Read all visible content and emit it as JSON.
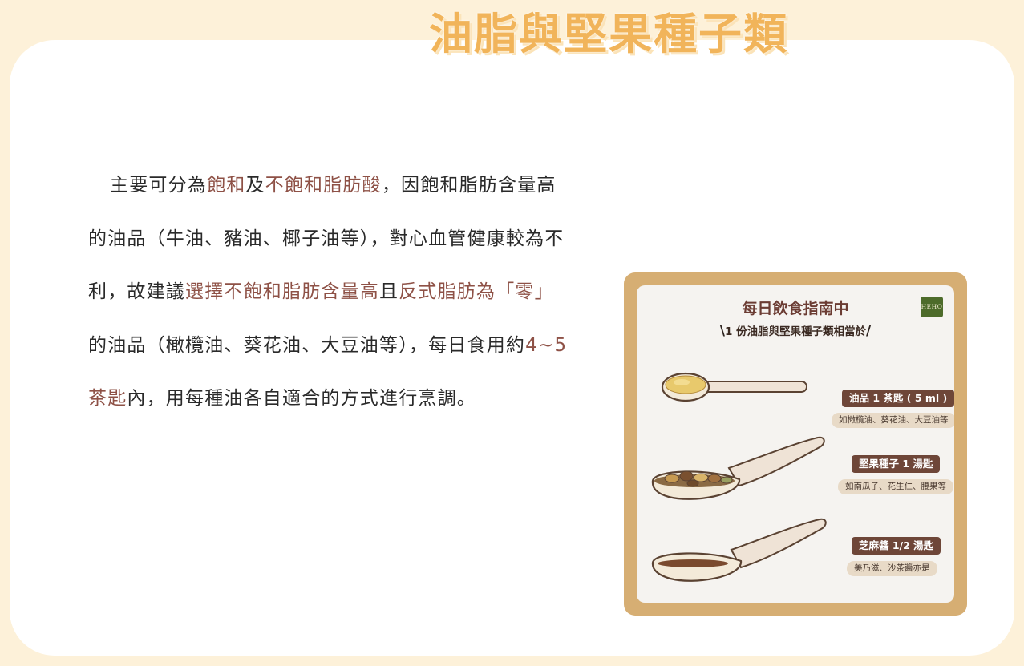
{
  "page": {
    "title": "油脂與堅果種子類"
  },
  "paragraph": {
    "seg1": "主要可分為",
    "seg2": "飽和",
    "seg3": "及",
    "seg4": "不飽和脂肪酸",
    "seg5": "，因飽和脂肪含量高的油品（牛油、豬油、椰子油等），對心血管健康較為不利，故建議",
    "seg6": "選擇不飽和脂肪含量高",
    "seg7": "且",
    "seg8": "反式脂肪為「零」",
    "seg9": "的油品（橄欖油、葵花油、大豆油等），每日食用約",
    "seg10": "4~5 茶匙",
    "seg11": "內，用每種油各自適合的方式進行烹調。"
  },
  "infographic": {
    "title": "每日飲食指南中",
    "subtitle": "1 份油脂與堅果種子類相當於",
    "logo": "HEHO",
    "items": [
      {
        "label": "油品 1 茶匙 ( 5 ml )",
        "examples": "如橄欖油、葵花油、大豆油等"
      },
      {
        "label": "堅果種子 1 湯匙",
        "examples": "如南瓜子、花生仁、腰果等"
      },
      {
        "label": "芝麻醬 1/2 湯匙",
        "examples": "美乃滋、沙茶醬亦是"
      }
    ]
  },
  "colors": {
    "title": "#f1b45a",
    "highlight": "#8e5146",
    "frame": "#d6ae73",
    "pill": "#6e4638",
    "background": "#fdf1d9"
  }
}
